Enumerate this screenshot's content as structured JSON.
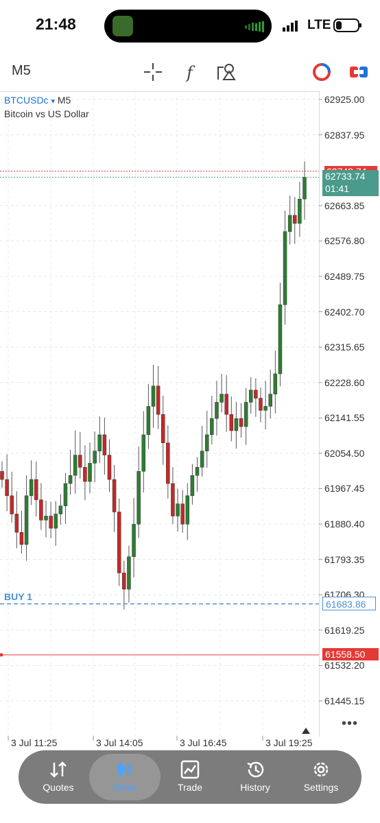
{
  "status_bar": {
    "time": "21:48",
    "carrier": "LTE"
  },
  "toolbar": {
    "timeframe": "M5",
    "icons": [
      "crosshair-icon",
      "function-icon",
      "objects-icon",
      "theme-icon",
      "trade-icon"
    ]
  },
  "chart": {
    "symbol": "BTCUSDc",
    "dropdown": "▾",
    "symbol_timeframe": "M5",
    "description": "Bitcoin vs US Dollar",
    "ask_price": "62733.74",
    "bar_timer": "01:41",
    "bid_price_hidden": "62748.74",
    "position_label": "BUY 1",
    "position_price": "61683.86",
    "sl_price": "61558.50",
    "colors": {
      "bull": "#2e7d32",
      "bear": "#c62828",
      "ask": "#4a9b8b",
      "sl": "#e53935",
      "position": "#4a90d9"
    }
  },
  "chart_data": {
    "type": "candlestick",
    "y_ticks": [
      "62925.00",
      "62837.95",
      "62663.85",
      "62576.80",
      "62489.75",
      "62402.70",
      "62315.65",
      "62228.60",
      "62141.55",
      "62054.50",
      "61967.45",
      "61880.40",
      "61793.35",
      "61706.30",
      "61619.25",
      "61532.20",
      "61445.15"
    ],
    "x_ticks": [
      "3 Jul 11:25",
      "3 Jul 14:05",
      "3 Jul 16:45",
      "3 Jul 19:25"
    ],
    "ylim": [
      61400,
      62960
    ],
    "closes": [
      61990,
      61950,
      61905,
      61860,
      61830,
      61950,
      61990,
      61940,
      61890,
      61900,
      61870,
      61905,
      61925,
      61980,
      62000,
      62050,
      62020,
      61985,
      62030,
      62060,
      62100,
      62050,
      61990,
      61910,
      61760,
      61720,
      61800,
      61880,
      62010,
      62100,
      62170,
      62220,
      62150,
      62080,
      61980,
      61900,
      61930,
      61880,
      61950,
      62000,
      62020,
      62060,
      62100,
      62140,
      62180,
      62200,
      62150,
      62110,
      62140,
      62120,
      62180,
      62210,
      62190,
      62160,
      62170,
      62200,
      62250,
      62420,
      62600,
      62640,
      62620,
      62680,
      62733.74
    ]
  },
  "nav": {
    "items": [
      {
        "label": "Quotes",
        "icon": "quotes-icon"
      },
      {
        "label": "Chart",
        "icon": "chart-icon"
      },
      {
        "label": "Trade",
        "icon": "trade-chart-icon"
      },
      {
        "label": "History",
        "icon": "history-icon"
      },
      {
        "label": "Settings",
        "icon": "settings-icon"
      }
    ],
    "active": "Chart"
  },
  "more": "•••"
}
